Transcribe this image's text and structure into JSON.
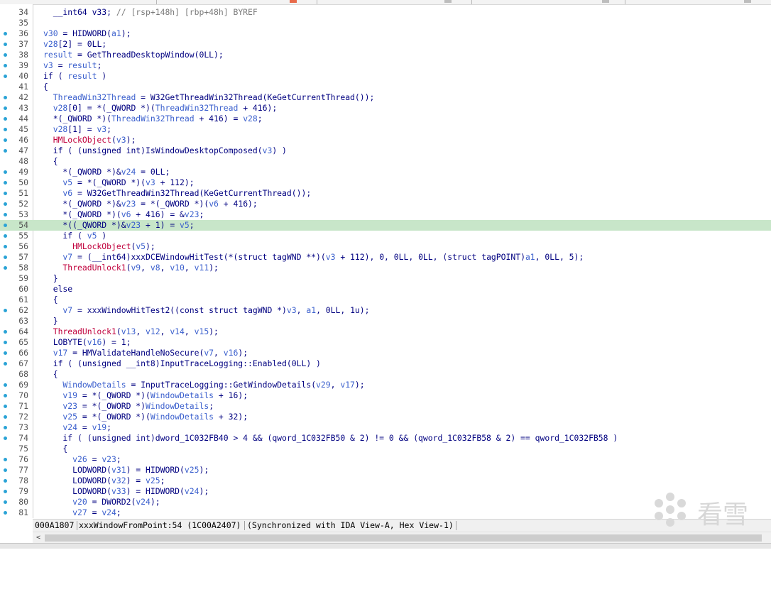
{
  "watermark_text": "看雪",
  "colors": {
    "highlight": "#c8e6c9",
    "breakpoint_dot": "#2aa3d6",
    "keyword": "#000080",
    "variable": "#3a5fcd",
    "function": "#c0003c",
    "comment": "#7a7a7a"
  },
  "code_lines": [
    {
      "ln": "34",
      "dot": false,
      "hl": false,
      "tokens": [
        {
          "c": "k",
          "t": "  __int64 v33; "
        },
        {
          "c": "c",
          "t": "// [rsp+148h] [rbp+48h] BYREF"
        }
      ]
    },
    {
      "ln": "35",
      "dot": false,
      "hl": false,
      "tokens": []
    },
    {
      "ln": "36",
      "dot": true,
      "hl": false,
      "tokens": [
        {
          "c": "v",
          "t": "v30"
        },
        {
          "c": "k",
          "t": " = HIDWORD("
        },
        {
          "c": "v",
          "t": "a1"
        },
        {
          "c": "k",
          "t": ");"
        }
      ]
    },
    {
      "ln": "37",
      "dot": true,
      "hl": false,
      "tokens": [
        {
          "c": "v",
          "t": "v28"
        },
        {
          "c": "k",
          "t": "[2] = 0LL;"
        }
      ]
    },
    {
      "ln": "38",
      "dot": true,
      "hl": false,
      "tokens": [
        {
          "c": "v",
          "t": "result"
        },
        {
          "c": "k",
          "t": " = GetThreadDesktopWindow(0LL);"
        }
      ]
    },
    {
      "ln": "39",
      "dot": true,
      "hl": false,
      "tokens": [
        {
          "c": "v",
          "t": "v3"
        },
        {
          "c": "k",
          "t": " = "
        },
        {
          "c": "v",
          "t": "result"
        },
        {
          "c": "k",
          "t": ";"
        }
      ]
    },
    {
      "ln": "40",
      "dot": true,
      "hl": false,
      "tokens": [
        {
          "c": "k",
          "t": "if ( "
        },
        {
          "c": "v",
          "t": "result"
        },
        {
          "c": "k",
          "t": " )"
        }
      ]
    },
    {
      "ln": "41",
      "dot": false,
      "hl": false,
      "tokens": [
        {
          "c": "k",
          "t": "{"
        }
      ]
    },
    {
      "ln": "42",
      "dot": true,
      "hl": false,
      "tokens": [
        {
          "c": "v",
          "t": "  ThreadWin32Thread"
        },
        {
          "c": "k",
          "t": " = W32GetThreadWin32Thread(KeGetCurrentThread());"
        }
      ]
    },
    {
      "ln": "43",
      "dot": true,
      "hl": false,
      "tokens": [
        {
          "c": "v",
          "t": "  v28"
        },
        {
          "c": "k",
          "t": "[0] = *(_QWORD *)("
        },
        {
          "c": "v",
          "t": "ThreadWin32Thread"
        },
        {
          "c": "k",
          "t": " + 416);"
        }
      ]
    },
    {
      "ln": "44",
      "dot": true,
      "hl": false,
      "tokens": [
        {
          "c": "k",
          "t": "  *(_QWORD *)("
        },
        {
          "c": "v",
          "t": "ThreadWin32Thread"
        },
        {
          "c": "k",
          "t": " + 416) = "
        },
        {
          "c": "v",
          "t": "v28"
        },
        {
          "c": "k",
          "t": ";"
        }
      ]
    },
    {
      "ln": "45",
      "dot": true,
      "hl": false,
      "tokens": [
        {
          "c": "v",
          "t": "  v28"
        },
        {
          "c": "k",
          "t": "[1] = "
        },
        {
          "c": "v",
          "t": "v3"
        },
        {
          "c": "k",
          "t": ";"
        }
      ]
    },
    {
      "ln": "46",
      "dot": true,
      "hl": false,
      "tokens": [
        {
          "c": "f",
          "t": "  HMLockObject"
        },
        {
          "c": "k",
          "t": "("
        },
        {
          "c": "v",
          "t": "v3"
        },
        {
          "c": "k",
          "t": ");"
        }
      ]
    },
    {
      "ln": "47",
      "dot": true,
      "hl": false,
      "tokens": [
        {
          "c": "k",
          "t": "  if ( (unsigned int)IsWindowDesktopComposed("
        },
        {
          "c": "v",
          "t": "v3"
        },
        {
          "c": "k",
          "t": ") )"
        }
      ]
    },
    {
      "ln": "48",
      "dot": false,
      "hl": false,
      "tokens": [
        {
          "c": "k",
          "t": "  {"
        }
      ]
    },
    {
      "ln": "49",
      "dot": true,
      "hl": false,
      "tokens": [
        {
          "c": "k",
          "t": "    *(_QWORD *)&"
        },
        {
          "c": "v",
          "t": "v24"
        },
        {
          "c": "k",
          "t": " = 0LL;"
        }
      ]
    },
    {
      "ln": "50",
      "dot": true,
      "hl": false,
      "tokens": [
        {
          "c": "v",
          "t": "    v5"
        },
        {
          "c": "k",
          "t": " = *(_QWORD *)("
        },
        {
          "c": "v",
          "t": "v3"
        },
        {
          "c": "k",
          "t": " + 112);"
        }
      ]
    },
    {
      "ln": "51",
      "dot": true,
      "hl": false,
      "tokens": [
        {
          "c": "v",
          "t": "    v6"
        },
        {
          "c": "k",
          "t": " = W32GetThreadWin32Thread(KeGetCurrentThread());"
        }
      ]
    },
    {
      "ln": "52",
      "dot": true,
      "hl": false,
      "tokens": [
        {
          "c": "k",
          "t": "    *(_QWORD *)&"
        },
        {
          "c": "v",
          "t": "v23"
        },
        {
          "c": "k",
          "t": " = *(_QWORD *)("
        },
        {
          "c": "v",
          "t": "v6"
        },
        {
          "c": "k",
          "t": " + 416);"
        }
      ]
    },
    {
      "ln": "53",
      "dot": true,
      "hl": false,
      "tokens": [
        {
          "c": "k",
          "t": "    *(_QWORD *)("
        },
        {
          "c": "v",
          "t": "v6"
        },
        {
          "c": "k",
          "t": " + 416) = &"
        },
        {
          "c": "v",
          "t": "v23"
        },
        {
          "c": "k",
          "t": ";"
        }
      ]
    },
    {
      "ln": "54",
      "dot": true,
      "hl": true,
      "tokens": [
        {
          "c": "k",
          "t": "    *((_QWORD *)&"
        },
        {
          "c": "v",
          "t": "v23"
        },
        {
          "c": "k",
          "t": " + 1) = "
        },
        {
          "c": "v",
          "t": "v5"
        },
        {
          "c": "k",
          "t": ";"
        }
      ]
    },
    {
      "ln": "55",
      "dot": true,
      "hl": false,
      "tokens": [
        {
          "c": "k",
          "t": "    if ( "
        },
        {
          "c": "v",
          "t": "v5"
        },
        {
          "c": "k",
          "t": " )"
        }
      ]
    },
    {
      "ln": "56",
      "dot": true,
      "hl": false,
      "tokens": [
        {
          "c": "f",
          "t": "      HMLockObject"
        },
        {
          "c": "k",
          "t": "("
        },
        {
          "c": "v",
          "t": "v5"
        },
        {
          "c": "k",
          "t": ");"
        }
      ]
    },
    {
      "ln": "57",
      "dot": true,
      "hl": false,
      "tokens": [
        {
          "c": "v",
          "t": "    v7"
        },
        {
          "c": "k",
          "t": " = (__int64)xxxDCEWindowHitTest(*(struct tagWND **)("
        },
        {
          "c": "v",
          "t": "v3"
        },
        {
          "c": "k",
          "t": " + 112), 0, 0LL, 0LL, (struct tagPOINT)"
        },
        {
          "c": "v",
          "t": "a1"
        },
        {
          "c": "k",
          "t": ", 0LL, 5);"
        }
      ]
    },
    {
      "ln": "58",
      "dot": true,
      "hl": false,
      "tokens": [
        {
          "c": "f",
          "t": "    ThreadUnlock1"
        },
        {
          "c": "k",
          "t": "("
        },
        {
          "c": "v",
          "t": "v9"
        },
        {
          "c": "k",
          "t": ", "
        },
        {
          "c": "v",
          "t": "v8"
        },
        {
          "c": "k",
          "t": ", "
        },
        {
          "c": "v",
          "t": "v10"
        },
        {
          "c": "k",
          "t": ", "
        },
        {
          "c": "v",
          "t": "v11"
        },
        {
          "c": "k",
          "t": ");"
        }
      ]
    },
    {
      "ln": "59",
      "dot": false,
      "hl": false,
      "tokens": [
        {
          "c": "k",
          "t": "  }"
        }
      ]
    },
    {
      "ln": "60",
      "dot": false,
      "hl": false,
      "tokens": [
        {
          "c": "k",
          "t": "  else"
        }
      ]
    },
    {
      "ln": "61",
      "dot": false,
      "hl": false,
      "tokens": [
        {
          "c": "k",
          "t": "  {"
        }
      ]
    },
    {
      "ln": "62",
      "dot": true,
      "hl": false,
      "tokens": [
        {
          "c": "v",
          "t": "    v7"
        },
        {
          "c": "k",
          "t": " = xxxWindowHitTest2((const struct tagWND *)"
        },
        {
          "c": "v",
          "t": "v3"
        },
        {
          "c": "k",
          "t": ", "
        },
        {
          "c": "v",
          "t": "a1"
        },
        {
          "c": "k",
          "t": ", 0LL, 1u);"
        }
      ]
    },
    {
      "ln": "63",
      "dot": false,
      "hl": false,
      "tokens": [
        {
          "c": "k",
          "t": "  }"
        }
      ]
    },
    {
      "ln": "64",
      "dot": true,
      "hl": false,
      "tokens": [
        {
          "c": "f",
          "t": "  ThreadUnlock1"
        },
        {
          "c": "k",
          "t": "("
        },
        {
          "c": "v",
          "t": "v13"
        },
        {
          "c": "k",
          "t": ", "
        },
        {
          "c": "v",
          "t": "v12"
        },
        {
          "c": "k",
          "t": ", "
        },
        {
          "c": "v",
          "t": "v14"
        },
        {
          "c": "k",
          "t": ", "
        },
        {
          "c": "v",
          "t": "v15"
        },
        {
          "c": "k",
          "t": ");"
        }
      ]
    },
    {
      "ln": "65",
      "dot": true,
      "hl": false,
      "tokens": [
        {
          "c": "k",
          "t": "  LOBYTE("
        },
        {
          "c": "v",
          "t": "v16"
        },
        {
          "c": "k",
          "t": ") = 1;"
        }
      ]
    },
    {
      "ln": "66",
      "dot": true,
      "hl": false,
      "tokens": [
        {
          "c": "v",
          "t": "  v17"
        },
        {
          "c": "k",
          "t": " = HMValidateHandleNoSecure("
        },
        {
          "c": "v",
          "t": "v7"
        },
        {
          "c": "k",
          "t": ", "
        },
        {
          "c": "v",
          "t": "v16"
        },
        {
          "c": "k",
          "t": ");"
        }
      ]
    },
    {
      "ln": "67",
      "dot": true,
      "hl": false,
      "tokens": [
        {
          "c": "k",
          "t": "  if ( (unsigned __int8)InputTraceLogging::Enabled(0LL) )"
        }
      ]
    },
    {
      "ln": "68",
      "dot": false,
      "hl": false,
      "tokens": [
        {
          "c": "k",
          "t": "  {"
        }
      ]
    },
    {
      "ln": "69",
      "dot": true,
      "hl": false,
      "tokens": [
        {
          "c": "v",
          "t": "    WindowDetails"
        },
        {
          "c": "k",
          "t": " = InputTraceLogging::GetWindowDetails("
        },
        {
          "c": "v",
          "t": "v29"
        },
        {
          "c": "k",
          "t": ", "
        },
        {
          "c": "v",
          "t": "v17"
        },
        {
          "c": "k",
          "t": ");"
        }
      ]
    },
    {
      "ln": "70",
      "dot": true,
      "hl": false,
      "tokens": [
        {
          "c": "v",
          "t": "    v19"
        },
        {
          "c": "k",
          "t": " = *(_QWORD *)("
        },
        {
          "c": "v",
          "t": "WindowDetails"
        },
        {
          "c": "k",
          "t": " + 16);"
        }
      ]
    },
    {
      "ln": "71",
      "dot": true,
      "hl": false,
      "tokens": [
        {
          "c": "v",
          "t": "    v23"
        },
        {
          "c": "k",
          "t": " = *(_OWORD *)"
        },
        {
          "c": "v",
          "t": "WindowDetails"
        },
        {
          "c": "k",
          "t": ";"
        }
      ]
    },
    {
      "ln": "72",
      "dot": true,
      "hl": false,
      "tokens": [
        {
          "c": "v",
          "t": "    v25"
        },
        {
          "c": "k",
          "t": " = *(_OWORD *)("
        },
        {
          "c": "v",
          "t": "WindowDetails"
        },
        {
          "c": "k",
          "t": " + 32);"
        }
      ]
    },
    {
      "ln": "73",
      "dot": true,
      "hl": false,
      "tokens": [
        {
          "c": "v",
          "t": "    v24"
        },
        {
          "c": "k",
          "t": " = "
        },
        {
          "c": "v",
          "t": "v19"
        },
        {
          "c": "k",
          "t": ";"
        }
      ]
    },
    {
      "ln": "74",
      "dot": true,
      "hl": false,
      "tokens": [
        {
          "c": "k",
          "t": "    if ( (unsigned int)dword_1C032FB40 > 4 && (qword_1C032FB50 & 2) != 0 && (qword_1C032FB58 & 2) == qword_1C032FB58 )"
        }
      ]
    },
    {
      "ln": "75",
      "dot": false,
      "hl": false,
      "tokens": [
        {
          "c": "k",
          "t": "    {"
        }
      ]
    },
    {
      "ln": "76",
      "dot": true,
      "hl": false,
      "tokens": [
        {
          "c": "v",
          "t": "      v26"
        },
        {
          "c": "k",
          "t": " = "
        },
        {
          "c": "v",
          "t": "v23"
        },
        {
          "c": "k",
          "t": ";"
        }
      ]
    },
    {
      "ln": "77",
      "dot": true,
      "hl": false,
      "tokens": [
        {
          "c": "k",
          "t": "      LODWORD("
        },
        {
          "c": "v",
          "t": "v31"
        },
        {
          "c": "k",
          "t": ") = HIDWORD("
        },
        {
          "c": "v",
          "t": "v25"
        },
        {
          "c": "k",
          "t": ");"
        }
      ]
    },
    {
      "ln": "78",
      "dot": true,
      "hl": false,
      "tokens": [
        {
          "c": "k",
          "t": "      LODWORD("
        },
        {
          "c": "v",
          "t": "v32"
        },
        {
          "c": "k",
          "t": ") = "
        },
        {
          "c": "v",
          "t": "v25"
        },
        {
          "c": "k",
          "t": ";"
        }
      ]
    },
    {
      "ln": "79",
      "dot": true,
      "hl": false,
      "tokens": [
        {
          "c": "k",
          "t": "      LODWORD("
        },
        {
          "c": "v",
          "t": "v33"
        },
        {
          "c": "k",
          "t": ") = HIDWORD("
        },
        {
          "c": "v",
          "t": "v24"
        },
        {
          "c": "k",
          "t": ");"
        }
      ]
    },
    {
      "ln": "80",
      "dot": true,
      "hl": false,
      "tokens": [
        {
          "c": "v",
          "t": "      v20"
        },
        {
          "c": "k",
          "t": " = DWORD2("
        },
        {
          "c": "v",
          "t": "v24"
        },
        {
          "c": "k",
          "t": ");"
        }
      ]
    },
    {
      "ln": "81",
      "dot": true,
      "hl": false,
      "tokens": [
        {
          "c": "v",
          "t": "      v27"
        },
        {
          "c": "k",
          "t": " = "
        },
        {
          "c": "v",
          "t": "v24"
        },
        {
          "c": "k",
          "t": ";"
        }
      ]
    }
  ],
  "status_bar": {
    "address": "000A1807",
    "location": "xxxWindowFromPoint:54 (1C00A2407)",
    "sync": "(Synchronized with IDA View-A, Hex View-1)"
  },
  "scrollbar": {
    "left_arrow": "<"
  }
}
